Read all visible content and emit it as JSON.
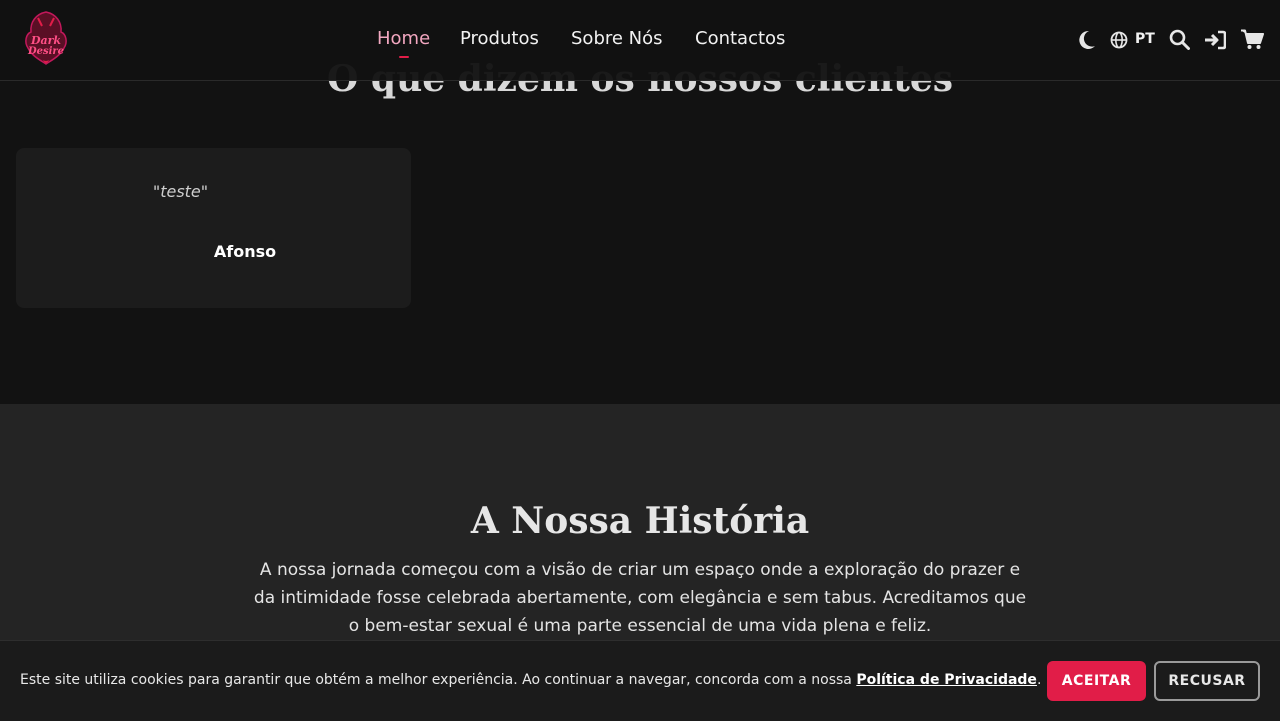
{
  "brand": {
    "logo_line1": "Dark",
    "logo_line2": "Desire",
    "accent": "#e11d48"
  },
  "nav": {
    "items": [
      {
        "label": "Home",
        "active": true
      },
      {
        "label": "Produtos"
      },
      {
        "label": "Sobre Nós"
      },
      {
        "label": "Contactos"
      }
    ]
  },
  "tools": {
    "theme_icon": "moon-icon",
    "language_icon": "globe-icon",
    "language": "PT",
    "search_icon": "search-icon",
    "login_icon": "sign-in-icon",
    "cart_icon": "cart-icon"
  },
  "testimonials": {
    "title": "O que dizem os nossos clientes",
    "items": [
      {
        "quote": "\"teste\"",
        "author": "Afonso"
      }
    ]
  },
  "history": {
    "title": "A Nossa História",
    "text": "A nossa jornada começou com a visão de criar um espaço onde a exploração do prazer e da intimidade fosse celebrada abertamente, com elegância e sem tabus. Acreditamos que o bem-estar sexual é uma parte essencial de uma vida plena e feliz."
  },
  "cookie": {
    "text": "Este site utiliza cookies para garantir que obtém a melhor experiência. Ao continuar a navegar, concorda com a nossa ",
    "link": "Política de Privacidade",
    "suffix": ".",
    "accept": "ACEITAR",
    "reject": "RECUSAR"
  }
}
